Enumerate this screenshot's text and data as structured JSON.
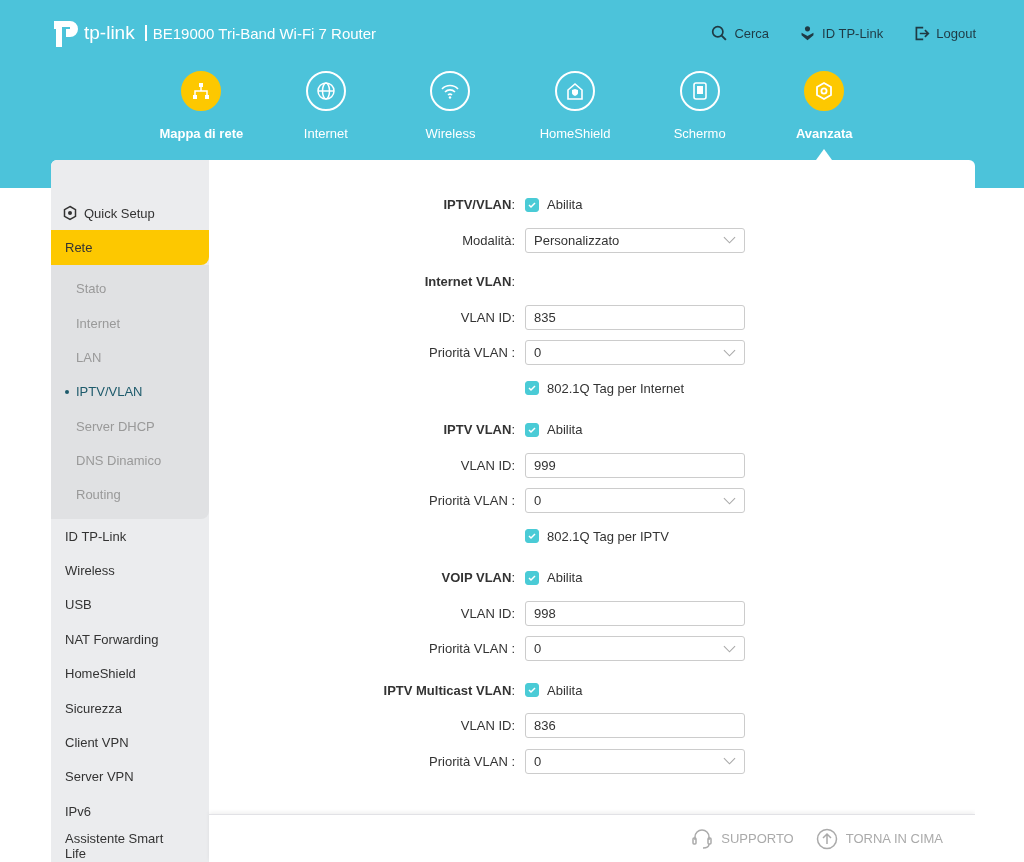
{
  "header": {
    "logo": "tp-link",
    "product": "BE19000 Tri-Band Wi-Fi 7 Router",
    "actions": [
      {
        "label": "Cerca"
      },
      {
        "label": "ID TP-Link"
      },
      {
        "label": "Logout"
      }
    ]
  },
  "nav": [
    {
      "label": "Mappa di rete",
      "active": true,
      "selected": false
    },
    {
      "label": "Internet",
      "active": false,
      "selected": false
    },
    {
      "label": "Wireless",
      "active": false,
      "selected": false
    },
    {
      "label": "HomeShield",
      "active": false,
      "selected": false
    },
    {
      "label": "Schermo",
      "active": false,
      "selected": false
    },
    {
      "label": "Avanzata",
      "active": true,
      "selected": true
    }
  ],
  "sidebar": {
    "items": [
      {
        "label": "Quick Setup",
        "kind": "setup"
      },
      {
        "label": "Rete",
        "kind": "group",
        "selected": true,
        "children": [
          {
            "label": "Stato",
            "selected": false
          },
          {
            "label": "Internet",
            "selected": false
          },
          {
            "label": "LAN",
            "selected": false
          },
          {
            "label": "IPTV/VLAN",
            "selected": true
          },
          {
            "label": "Server DHCP",
            "selected": false
          },
          {
            "label": "DNS Dinamico",
            "selected": false
          },
          {
            "label": "Routing",
            "selected": false
          }
        ]
      },
      {
        "label": "ID TP-Link",
        "kind": "item",
        "selected": false
      },
      {
        "label": "Wireless",
        "kind": "item",
        "selected": false
      },
      {
        "label": "USB",
        "kind": "item",
        "selected": false
      },
      {
        "label": "NAT Forwarding",
        "kind": "item",
        "selected": false
      },
      {
        "label": "HomeShield",
        "kind": "item",
        "selected": false
      },
      {
        "label": "Sicurezza",
        "kind": "item",
        "selected": false
      },
      {
        "label": "Client VPN",
        "kind": "item",
        "selected": false
      },
      {
        "label": "Server VPN",
        "kind": "item",
        "selected": false
      },
      {
        "label": "IPv6",
        "kind": "item",
        "selected": false
      },
      {
        "label": "Assistente Smart Life",
        "kind": "item",
        "selected": false
      }
    ]
  },
  "form": {
    "sections": [
      {
        "rows": [
          {
            "kind": "checkbox",
            "label": "**IPTV/VLAN**:",
            "text": "Abilita",
            "checked": true
          },
          {
            "kind": "select",
            "label": "Modalità:",
            "value": "Personalizzato"
          }
        ]
      },
      {
        "rows": [
          {
            "kind": "heading",
            "label": "**Internet VLAN**:"
          },
          {
            "kind": "input",
            "label": "VLAN ID:",
            "value": "835"
          },
          {
            "kind": "select",
            "label": "Priorità VLAN :",
            "value": "0"
          },
          {
            "kind": "checkbox",
            "text": "802.1Q Tag per Internet",
            "checked": true
          }
        ]
      },
      {
        "rows": [
          {
            "kind": "checkbox",
            "label": "**IPTV VLAN**:",
            "text": "Abilita",
            "checked": true
          },
          {
            "kind": "input",
            "label": "VLAN ID:",
            "value": "999"
          },
          {
            "kind": "select",
            "label": "Priorità VLAN :",
            "value": "0"
          },
          {
            "kind": "checkbox",
            "text": "802.1Q Tag per IPTV",
            "checked": true
          }
        ]
      },
      {
        "rows": [
          {
            "kind": "checkbox",
            "label": "**VOIP VLAN**:",
            "text": "Abilita",
            "checked": true
          },
          {
            "kind": "input",
            "label": "VLAN ID:",
            "value": "998"
          },
          {
            "kind": "select",
            "label": "Priorità VLAN :",
            "value": "0"
          }
        ]
      },
      {
        "rows": [
          {
            "kind": "checkbox",
            "label": "**IPTV Multicast VLAN**:",
            "text": "Abilita",
            "checked": true
          },
          {
            "kind": "input",
            "label": "VLAN ID:",
            "value": "836"
          },
          {
            "kind": "select",
            "label": "Priorità VLAN :",
            "value": "0"
          }
        ]
      }
    ]
  },
  "footer": [
    {
      "label": "SUPPORTO"
    },
    {
      "label": "TORNA IN CIMA"
    }
  ]
}
